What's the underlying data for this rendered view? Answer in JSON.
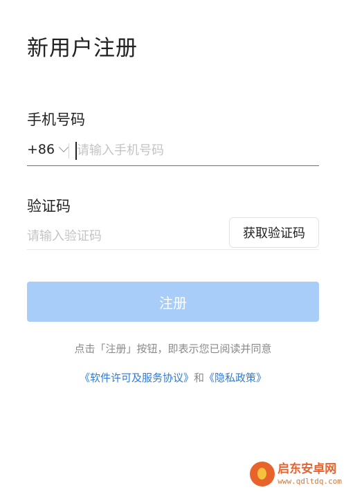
{
  "header": {
    "title": "新用户注册"
  },
  "phone": {
    "label": "手机号码",
    "country_code": "+86",
    "placeholder": "请输入手机号码",
    "value": ""
  },
  "code": {
    "label": "验证码",
    "placeholder": "请输入验证码",
    "value": "",
    "get_code_label": "获取验证码"
  },
  "register": {
    "label": "注册",
    "enabled": false
  },
  "agreement": {
    "text": "点击「注册」按钮，即表示您已阅读并同意",
    "link1": "《软件许可及服务协议》",
    "connector": "和",
    "link2": "《隐私政策》"
  },
  "watermark": {
    "name": "启东安卓网",
    "url": "www.qdltdq.com"
  },
  "colors": {
    "accent": "#2f7bd6",
    "button_disabled": "#a9cdf9",
    "placeholder": "#c4c4c4",
    "watermark": "#e8632b"
  }
}
